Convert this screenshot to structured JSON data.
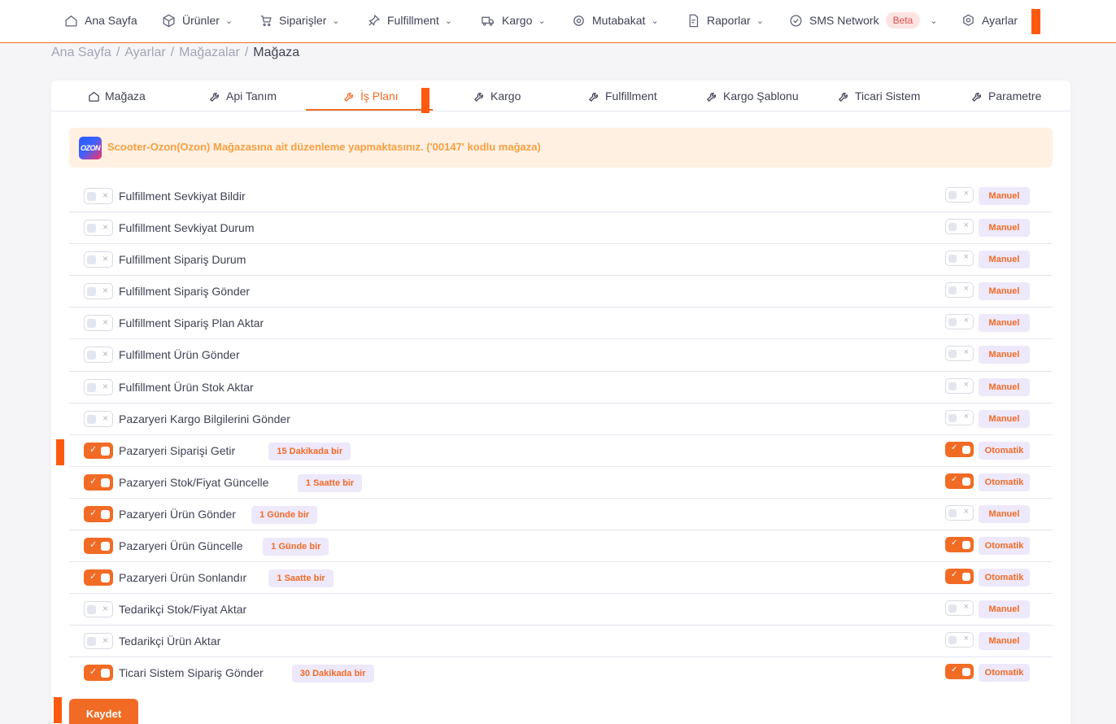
{
  "nav": {
    "items": [
      {
        "label": "Ana Sayfa",
        "icon": "home-icon",
        "dropdown": false
      },
      {
        "label": "Ürünler",
        "icon": "box-icon",
        "dropdown": true
      },
      {
        "label": "Siparişler",
        "icon": "orders-icon",
        "dropdown": true
      },
      {
        "label": "Fulfillment",
        "icon": "pin-icon",
        "dropdown": true
      },
      {
        "label": "Kargo",
        "icon": "truck-icon",
        "dropdown": true
      },
      {
        "label": "Mutabakat",
        "icon": "reconcile-icon",
        "dropdown": true
      },
      {
        "label": "Raporlar",
        "icon": "report-icon",
        "dropdown": true
      },
      {
        "label": "SMS Network",
        "icon": "check-circle-icon",
        "dropdown": true,
        "badge": "Beta"
      },
      {
        "label": "Ayarlar",
        "icon": "gear-icon",
        "dropdown": false
      }
    ]
  },
  "breadcrumb": {
    "items": [
      "Ana Sayfa",
      "Ayarlar",
      "Mağazalar"
    ],
    "current": "Mağaza"
  },
  "tabs": [
    {
      "label": "Mağaza",
      "icon": "home-icon",
      "active": false
    },
    {
      "label": "Api Tanım",
      "icon": "wrench-icon",
      "active": false
    },
    {
      "label": "İş Planı",
      "icon": "wrench-icon",
      "active": true
    },
    {
      "label": "Kargo",
      "icon": "wrench-icon",
      "active": false
    },
    {
      "label": "Fulfillment",
      "icon": "wrench-icon",
      "active": false
    },
    {
      "label": "Kargo Şablonu",
      "icon": "wrench-icon",
      "active": false
    },
    {
      "label": "Ticari Sistem",
      "icon": "wrench-icon",
      "active": false
    },
    {
      "label": "Parametre",
      "icon": "wrench-icon",
      "active": false
    }
  ],
  "alert": {
    "logo_text": "OZON",
    "text": "Scooter-Ozon(Ozon) Mağazasına ait düzenleme yapmaktasınız. ('00147' kodlu mağaza)"
  },
  "jobs": [
    {
      "label": "Fulfillment Sevkiyat Bildir",
      "enabled": false,
      "frequency": "",
      "auto": false,
      "mode": "Manuel"
    },
    {
      "label": "Fulfillment Sevkiyat Durum",
      "enabled": false,
      "frequency": "",
      "auto": false,
      "mode": "Manuel"
    },
    {
      "label": "Fulfillment Sipariş Durum",
      "enabled": false,
      "frequency": "",
      "auto": false,
      "mode": "Manuel"
    },
    {
      "label": "Fulfillment Sipariş Gönder",
      "enabled": false,
      "frequency": "",
      "auto": false,
      "mode": "Manuel"
    },
    {
      "label": "Fulfillment Sipariş Plan Aktar",
      "enabled": false,
      "frequency": "",
      "auto": false,
      "mode": "Manuel"
    },
    {
      "label": "Fulfillment Ürün Gönder",
      "enabled": false,
      "frequency": "",
      "auto": false,
      "mode": "Manuel"
    },
    {
      "label": "Fulfillment Ürün Stok Aktar",
      "enabled": false,
      "frequency": "",
      "auto": false,
      "mode": "Manuel"
    },
    {
      "label": "Pazaryeri Kargo Bilgilerini Gönder",
      "enabled": false,
      "frequency": "",
      "auto": false,
      "mode": "Manuel"
    },
    {
      "label": "Pazaryeri Siparişi Getir",
      "enabled": true,
      "frequency": "15 Dakikada bir",
      "auto": true,
      "mode": "Otomatik"
    },
    {
      "label": "Pazaryeri Stok/Fiyat Güncelle",
      "enabled": true,
      "frequency": "1 Saatte bir",
      "auto": true,
      "mode": "Otomatik"
    },
    {
      "label": "Pazaryeri Ürün Gönder",
      "enabled": true,
      "frequency": "1 Günde bir",
      "auto": false,
      "mode": "Manuel"
    },
    {
      "label": "Pazaryeri Ürün Güncelle",
      "enabled": true,
      "frequency": "1 Günde bir",
      "auto": true,
      "mode": "Otomatik"
    },
    {
      "label": "Pazaryeri Ürün Sonlandır",
      "enabled": true,
      "frequency": "1 Saatte bir",
      "auto": true,
      "mode": "Otomatik"
    },
    {
      "label": "Tedarikçi Stok/Fiyat Aktar",
      "enabled": false,
      "frequency": "",
      "auto": false,
      "mode": "Manuel"
    },
    {
      "label": "Tedarikçi Ürün Aktar",
      "enabled": false,
      "frequency": "",
      "auto": false,
      "mode": "Manuel"
    },
    {
      "label": "Ticari Sistem Sipariş Gönder",
      "enabled": true,
      "frequency": "30 Dakikada bir",
      "auto": true,
      "mode": "Otomatik"
    }
  ],
  "save_label": "Kaydet",
  "colors": {
    "accent": "#f26b25",
    "marker": "#ff5a0f",
    "alert_bg": "#fff0e2",
    "alert_text": "#f7a041",
    "badge_bg": "#eee8fb"
  }
}
